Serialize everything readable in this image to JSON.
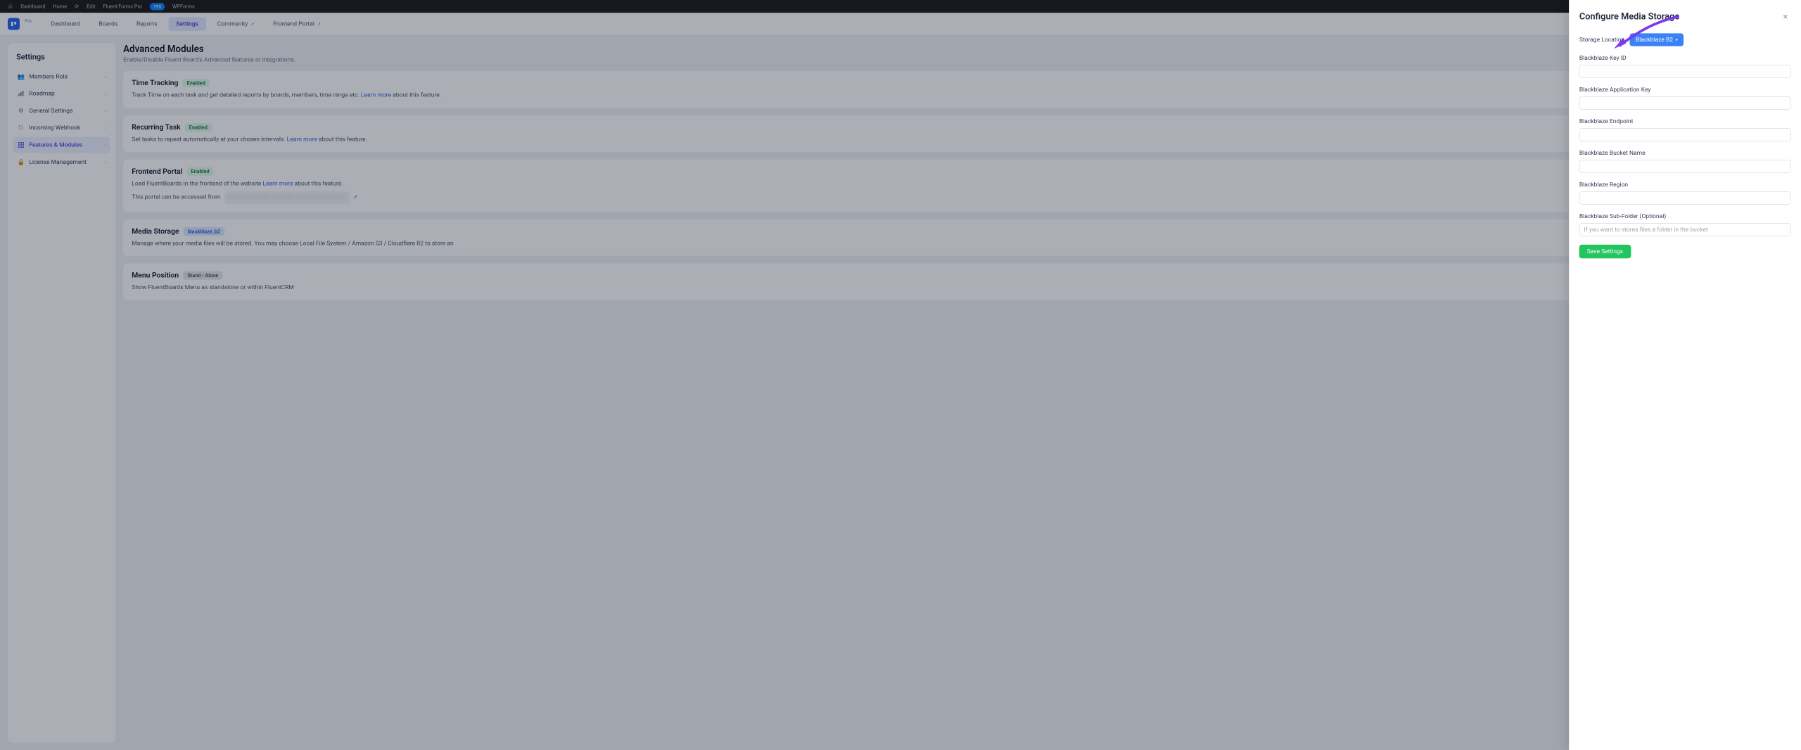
{
  "topbar": {
    "a": "Dashboard",
    "b": "Home",
    "c": "",
    "d": "Edit",
    "e": "Fluent Forms Pro",
    "pill": "195",
    "f": "WPForms"
  },
  "header": {
    "plan": "Pro",
    "nav": [
      {
        "label": "Dashboard",
        "active": false
      },
      {
        "label": "Boards",
        "active": false
      },
      {
        "label": "Reports",
        "active": false
      },
      {
        "label": "Settings",
        "active": true
      },
      {
        "label": "Community",
        "ext": true
      },
      {
        "label": "Frontend Portal",
        "ext": true
      }
    ]
  },
  "sidebar": {
    "title": "Settings",
    "items": [
      {
        "label": "Members Role"
      },
      {
        "label": "Roadmap"
      },
      {
        "label": "General Settings"
      },
      {
        "label": "Incoming Webhook"
      },
      {
        "label": "Features & Modules",
        "active": true
      },
      {
        "label": "License Management"
      }
    ]
  },
  "page": {
    "title": "Advanced Modules",
    "subtitle": "Enable/Disable Fluent Board's Advanced features or integrations."
  },
  "cards": {
    "time": {
      "title": "Time Tracking",
      "badge": "Enabled",
      "d1": "Track Time on each task and get detailed reports by boards, members, time range etc. ",
      "link": "Learn more",
      "d2": " about this feature."
    },
    "recurring": {
      "title": "Recurring Task",
      "badge": "Enabled",
      "d1": "Set tasks to repeat automatically at your chosen intervals. ",
      "link": "Learn more",
      "d2": " about this feature."
    },
    "frontend": {
      "title": "Frontend Portal",
      "badge": "Enabled",
      "d1": "Load FluentBoards in the frontend of the website ",
      "link": "Learn more",
      "d2": " about this feature.",
      "portal_label": "This portal can be accessed from",
      "portal_url": "https://example.example.example/example/"
    },
    "media": {
      "title": "Media Storage",
      "badge": "blackblaze_b2",
      "desc": "Manage where your media files will be stored. You may choose Local File System / Amazon S3 / Cloudflare R2 to store an"
    },
    "menu": {
      "title": "Menu Position",
      "badge": "Stand - Alone",
      "desc": "Show FluentBoards Menu as standalone or within FluentCRM"
    }
  },
  "drawer": {
    "title": "Configure Media Storage",
    "storage_location_label": "Storage Location",
    "storage_location_value": "Blackblaze B2",
    "fields": [
      {
        "label": "Blackblaze Key ID"
      },
      {
        "label": "Blackblaze Application Key"
      },
      {
        "label": "Blackblaze Endpoint"
      },
      {
        "label": "Blackblaze Bucket Name"
      },
      {
        "label": "Blackblaze Region"
      }
    ],
    "sub_folder_label": "Blackblaze Sub-Folder (Optional)",
    "sub_folder_placeholder": "If you want to stores files a folder in the bucket",
    "save": "Save Settings"
  }
}
